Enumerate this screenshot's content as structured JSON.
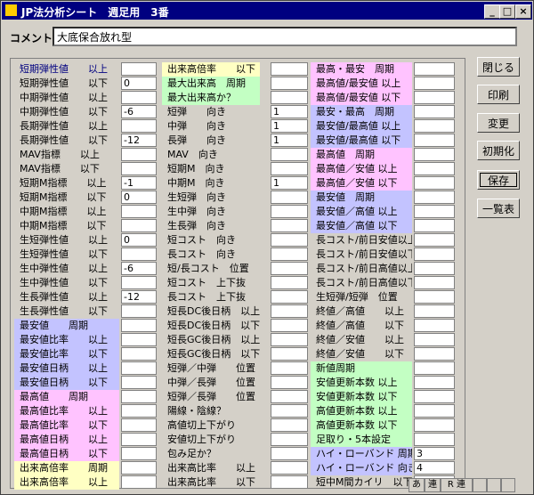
{
  "window": {
    "title": "JP法分析シート　週足用　3番",
    "min": "_",
    "max": "□",
    "close": "×"
  },
  "comment": {
    "label": "コメント",
    "value": "大底保合放れ型"
  },
  "col1": [
    {
      "label": "短期弾性値　　以上",
      "value": "",
      "color": "none",
      "title": true
    },
    {
      "label": "短期弾性値　　以下",
      "value": "0",
      "color": "none"
    },
    {
      "label": "中期弾性値　　以上",
      "value": "",
      "color": "none"
    },
    {
      "label": "中期弾性値　　以下",
      "value": "-6",
      "color": "none"
    },
    {
      "label": "長期弾性値　　以上",
      "value": "",
      "color": "none"
    },
    {
      "label": "長期弾性値　　以下",
      "value": "-12",
      "color": "none"
    },
    {
      "label": "MAV指標　　以上",
      "value": "",
      "color": "none"
    },
    {
      "label": "MAV指標　　以下",
      "value": "",
      "color": "none"
    },
    {
      "label": "短期M指標　　以上",
      "value": "-1",
      "color": "none"
    },
    {
      "label": "短期M指標　　以下",
      "value": "0",
      "color": "none"
    },
    {
      "label": "中期M指標　　以上",
      "value": "",
      "color": "none"
    },
    {
      "label": "中期M指標　　以下",
      "value": "",
      "color": "none"
    },
    {
      "label": "生短弾性値　　以上",
      "value": "0",
      "color": "none"
    },
    {
      "label": "生短弾性値　　以下",
      "value": "",
      "color": "none"
    },
    {
      "label": "生中弾性値　　以上",
      "value": "-6",
      "color": "none"
    },
    {
      "label": "生中弾性値　　以下",
      "value": "",
      "color": "none"
    },
    {
      "label": "生長弾性値　　以上",
      "value": "-12",
      "color": "none"
    },
    {
      "label": "生長弾性値　　以下",
      "value": "",
      "color": "none"
    },
    {
      "label": "最安値　　周期",
      "value": "",
      "color": "blue"
    },
    {
      "label": "最安値比率　　以上",
      "value": "",
      "color": "blue"
    },
    {
      "label": "最安値比率　　以下",
      "value": "",
      "color": "blue"
    },
    {
      "label": "最安値日柄　　以上",
      "value": "",
      "color": "blue"
    },
    {
      "label": "最安値日柄　　以下",
      "value": "",
      "color": "blue"
    },
    {
      "label": "最高値　　周期",
      "value": "",
      "color": "pink"
    },
    {
      "label": "最高値比率　　以上",
      "value": "",
      "color": "pink"
    },
    {
      "label": "最高値比率　　以下",
      "value": "",
      "color": "pink"
    },
    {
      "label": "最高値日柄　　以上",
      "value": "",
      "color": "pink"
    },
    {
      "label": "最高値日柄　　以下",
      "value": "",
      "color": "pink"
    },
    {
      "label": "出来高倍率　　周期",
      "value": "",
      "color": "yellow"
    },
    {
      "label": "出来高倍率　　以上",
      "value": "",
      "color": "yellow"
    }
  ],
  "col2": [
    {
      "label": "出来高倍率　　以下",
      "value": "",
      "color": "yellow"
    },
    {
      "label": "最大出来高　周期",
      "value": "",
      "color": "green"
    },
    {
      "label": "最大出来高か？",
      "value": "",
      "color": "green"
    },
    {
      "label": "短弾　　向き",
      "value": "1",
      "color": "none"
    },
    {
      "label": "中弾　　向き",
      "value": "1",
      "color": "none"
    },
    {
      "label": "長弾　　向き",
      "value": "1",
      "color": "none"
    },
    {
      "label": "MAV　向き",
      "value": "",
      "color": "none"
    },
    {
      "label": "短期M　向き",
      "value": "",
      "color": "none"
    },
    {
      "label": "中期M　向き",
      "value": "1",
      "color": "none"
    },
    {
      "label": "生短弾　向き",
      "value": "",
      "color": "none"
    },
    {
      "label": "生中弾　向き",
      "value": "",
      "color": "none"
    },
    {
      "label": "生長弾　向き",
      "value": "",
      "color": "none"
    },
    {
      "label": "短コスト　向き",
      "value": "",
      "color": "none"
    },
    {
      "label": "長コスト　向き",
      "value": "",
      "color": "none"
    },
    {
      "label": "短/長コスト　位置",
      "value": "",
      "color": "none"
    },
    {
      "label": "短コスト　上下抜",
      "value": "",
      "color": "none"
    },
    {
      "label": "長コスト　上下抜",
      "value": "",
      "color": "none"
    },
    {
      "label": "短長DC後日柄　以上",
      "value": "",
      "color": "none"
    },
    {
      "label": "短長DC後日柄　以下",
      "value": "",
      "color": "none"
    },
    {
      "label": "短長GC後日柄　以上",
      "value": "",
      "color": "none"
    },
    {
      "label": "短長GC後日柄　以下",
      "value": "",
      "color": "none"
    },
    {
      "label": "短弾／中弾　　位置",
      "value": "",
      "color": "none"
    },
    {
      "label": "中弾／長弾　　位置",
      "value": "",
      "color": "none"
    },
    {
      "label": "短弾／長弾　　位置",
      "value": "",
      "color": "none"
    },
    {
      "label": "陽線・陰線？",
      "value": "",
      "color": "none"
    },
    {
      "label": "高値切上下がり",
      "value": "",
      "color": "none"
    },
    {
      "label": "安値切上下がり",
      "value": "",
      "color": "none"
    },
    {
      "label": "包み足か？",
      "value": "",
      "color": "none"
    },
    {
      "label": "出来高比率　　以上",
      "value": "",
      "color": "none"
    },
    {
      "label": "出来高比率　　以下",
      "value": "",
      "color": "none"
    }
  ],
  "col3": [
    {
      "label": "最高・最安　周期",
      "value": "",
      "color": "pink"
    },
    {
      "label": "最高値/最安値 以上",
      "value": "",
      "color": "pink"
    },
    {
      "label": "最高値/最安値 以下",
      "value": "",
      "color": "pink"
    },
    {
      "label": "最安・最高　周期",
      "value": "",
      "color": "blue"
    },
    {
      "label": "最安値/最高値 以上",
      "value": "",
      "color": "blue"
    },
    {
      "label": "最安値/最高値 以下",
      "value": "",
      "color": "blue"
    },
    {
      "label": "最高値　周期",
      "value": "",
      "color": "pink"
    },
    {
      "label": "最高値／安値 以上",
      "value": "",
      "color": "pink"
    },
    {
      "label": "最高値／安値 以下",
      "value": "",
      "color": "pink"
    },
    {
      "label": "最安値　周期",
      "value": "",
      "color": "blue"
    },
    {
      "label": "最安値／高値 以上",
      "value": "",
      "color": "blue"
    },
    {
      "label": "最安値／高値 以下",
      "value": "",
      "color": "blue"
    },
    {
      "label": "長コスト/前日安値以上",
      "value": "",
      "color": "none"
    },
    {
      "label": "長コスト/前日安値以下",
      "value": "",
      "color": "none"
    },
    {
      "label": "長コスト/前日高値以上",
      "value": "",
      "color": "none"
    },
    {
      "label": "長コスト/前日高値以下",
      "value": "",
      "color": "none"
    },
    {
      "label": "生短弾/短弾　位置",
      "value": "",
      "color": "none"
    },
    {
      "label": "終値／高値　　以上",
      "value": "",
      "color": "none"
    },
    {
      "label": "終値／高値　　以下",
      "value": "",
      "color": "none"
    },
    {
      "label": "終値／安値　　以上",
      "value": "",
      "color": "none"
    },
    {
      "label": "終値／安値　　以下",
      "value": "",
      "color": "none"
    },
    {
      "label": "新値周期",
      "value": "",
      "color": "green"
    },
    {
      "label": "安値更新本数 以上",
      "value": "",
      "color": "green"
    },
    {
      "label": "安値更新本数 以下",
      "value": "",
      "color": "green"
    },
    {
      "label": "高値更新本数 以上",
      "value": "",
      "color": "green"
    },
    {
      "label": "高値更新本数 以下",
      "value": "",
      "color": "green"
    },
    {
      "label": "足取り・5本設定",
      "value": "",
      "color": "green"
    },
    {
      "label": "ハイ・ローバンド 周期",
      "value": "3",
      "color": "blue"
    },
    {
      "label": "ハイ・ローバンド 向き",
      "value": "4",
      "color": "blue"
    },
    {
      "label": "短中M間カイリ　以下",
      "value": "",
      "color": "none"
    }
  ],
  "buttons": [
    "閉じる",
    "印刷",
    "変更",
    "初期化",
    "保存",
    "一覧表"
  ],
  "status": [
    "あ",
    "連",
    "R 連"
  ]
}
